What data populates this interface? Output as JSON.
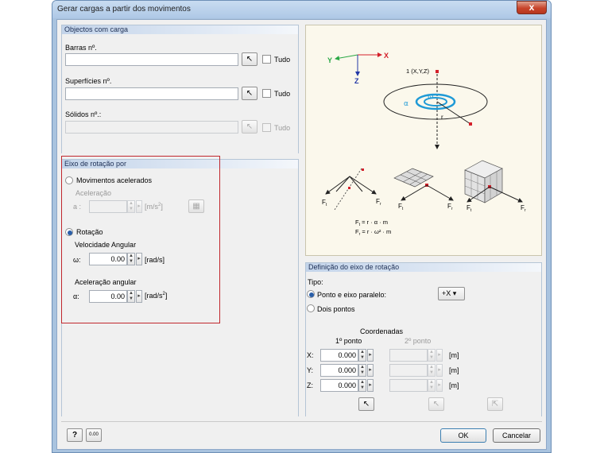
{
  "dialog": {
    "title": "Gerar cargas a partir dos movimentos",
    "close_glyph": "x"
  },
  "loaded_objects": {
    "header": "Objectos com carga",
    "members_label": "Barras nº.",
    "members_value": "",
    "surfaces_label": "Superfícies nº.",
    "surfaces_value": "",
    "solids_label": "Sólidos nº.:",
    "solids_value": "",
    "all_label": "Tudo"
  },
  "rotation_axis": {
    "header": "Eixo de rotação por",
    "accelerated_label": "Movimentos acelerados",
    "acceleration_label": "Aceleração",
    "a_label": "a :",
    "a_value": "",
    "a_unit": "[m/s",
    "a_unit_exp": "2",
    "a_unit_end": "]",
    "rotation_label": "Rotação",
    "angular_velocity_label": "Velocidade Angular",
    "omega_label": "ω:",
    "omega_value": "0.00",
    "omega_unit": "[rad/s]",
    "angular_accel_label": "Aceleração angular",
    "alpha_label": "α:",
    "alpha_value": "0.00",
    "alpha_unit": "[rad/s",
    "alpha_unit_exp": "2",
    "alpha_unit_end": "]"
  },
  "graphic": {
    "axis_y": "Y",
    "axis_x": "X",
    "axis_z": "Z",
    "point_label": "1 (X,Y,Z)",
    "alpha": "α",
    "omega": "ω",
    "r": "r",
    "ft": "F",
    "ft_sub": "t",
    "fr": "F",
    "fr_sub": "r",
    "formula1": "F  = r · α · m",
    "formula2": "F  = r · ω² · m"
  },
  "axis_definition": {
    "header": "Definição do eixo de rotação",
    "type_label": "Tipo:",
    "point_parallel_label": "Ponto e eixo paralelo:",
    "direction_value": "+X",
    "two_points_label": "Dois pontos",
    "coordinates_label": "Coordenadas",
    "point1_label": "1º ponto",
    "point2_label": "2º ponto",
    "rows": [
      {
        "axis": "X:",
        "p1": "0.000",
        "p2": "",
        "unit": "[m]"
      },
      {
        "axis": "Y:",
        "p1": "0.000",
        "p2": "",
        "unit": "[m]"
      },
      {
        "axis": "Z:",
        "p1": "0.000",
        "p2": "",
        "unit": "[m]"
      }
    ]
  },
  "footer": {
    "ok_label": "OK",
    "cancel_label": "Cancelar",
    "units_icon_text": "0.00"
  },
  "colors": {
    "accent": "#2b5fa8",
    "highlight_box": "#c0272d",
    "axis_red": "#d4202a",
    "rotation_blue": "#1f9ad6"
  }
}
